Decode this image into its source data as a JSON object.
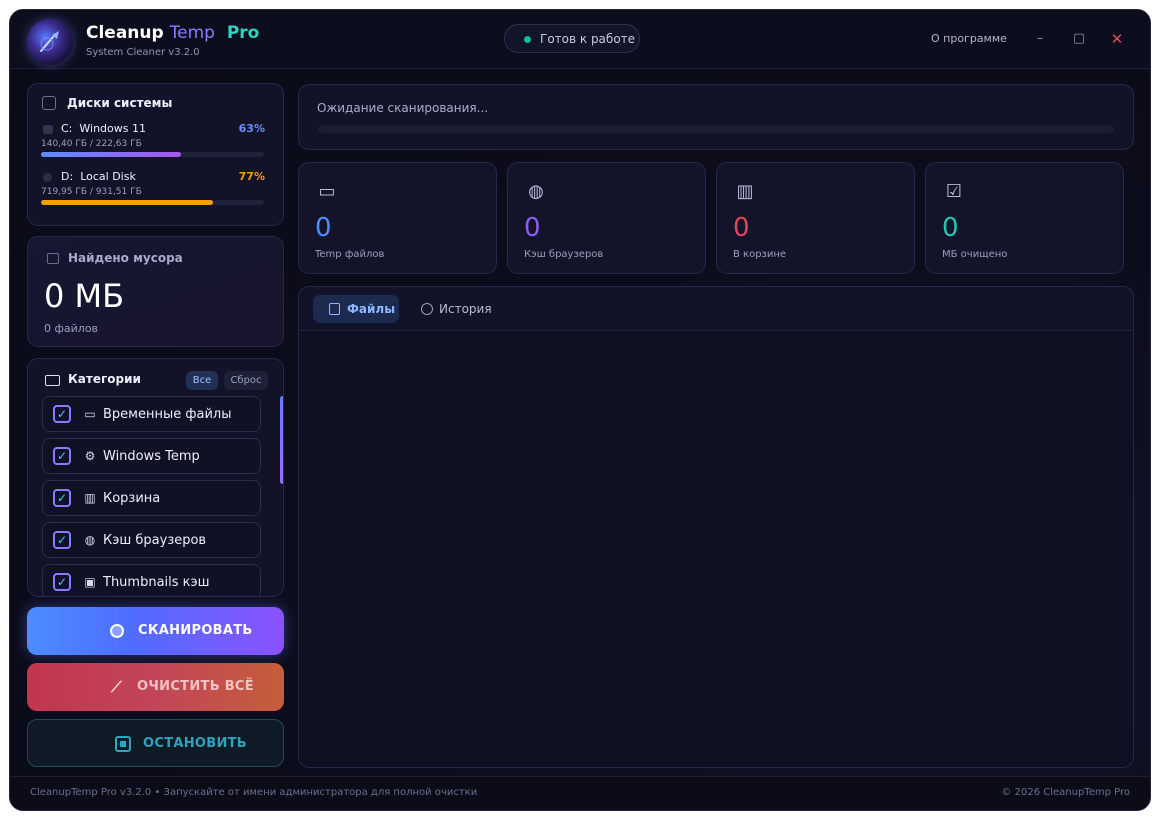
{
  "app": {
    "title_part1": "Cleanup",
    "title_part2": "Temp",
    "title_part3": "Pro",
    "subtitle": "System Cleaner v3.2.0",
    "status": "Готов к работе",
    "about": "О программе",
    "min_icon": "minimize-icon",
    "max_icon": "maximize-icon",
    "close_icon": "close-icon"
  },
  "disks": {
    "header": "Диски системы",
    "items": [
      {
        "letter": "C:",
        "name": "Windows 11",
        "percent": "63%",
        "size": "140,40 ГБ / 222,63 ГБ",
        "fill": 0.63,
        "color": "#6b8cff"
      },
      {
        "letter": "D:",
        "name": "Local Disk",
        "percent": "77%",
        "size": "719,95 ГБ / 931,51 ГБ",
        "fill": 0.77,
        "color": "#f59e0b"
      }
    ]
  },
  "found": {
    "header": "Найдено мусора",
    "value": "0 МБ",
    "count": "0 файлов"
  },
  "categories": {
    "header": "Категории",
    "all_label": "Все",
    "reset_label": "Сброс",
    "items": [
      {
        "label": "Временные файлы",
        "icon": "folder-icon",
        "glyph": "▭",
        "checked": true
      },
      {
        "label": "Windows Temp",
        "icon": "gear-icon",
        "glyph": "⚙",
        "checked": true
      },
      {
        "label": "Корзина",
        "icon": "trash-icon",
        "glyph": "🗑",
        "checked": true
      },
      {
        "label": "Кэш браузеров",
        "icon": "globe-icon",
        "glyph": "◍",
        "checked": true
      },
      {
        "label": "Thumbnails кэш",
        "icon": "image-icon",
        "glyph": "▣",
        "checked": true
      }
    ]
  },
  "actions": {
    "scan": "СКАНИРОВАТЬ",
    "clean": "ОЧИСТИТЬ ВСЁ",
    "stop": "ОСТАНОВИТЬ"
  },
  "progress": {
    "text": "Ожидание сканирования...",
    "value": 0
  },
  "stats": [
    {
      "value": "0",
      "label": "Temp файлов",
      "icon": "folder-icon",
      "color": "#4c8dff"
    },
    {
      "value": "0",
      "label": "Кэш браузеров",
      "icon": "globe-icon",
      "color": "#8b5cf6"
    },
    {
      "value": "0",
      "label": "В корзине",
      "icon": "trash-icon",
      "color": "#e0455f"
    },
    {
      "value": "0",
      "label": "МБ очищено",
      "icon": "check-icon",
      "color": "#22c5b0"
    }
  ],
  "tabs": {
    "files": "Файлы",
    "history": "История"
  },
  "footer": {
    "left": "CleanupTemp Pro v3.2.0  •  Запускайте от имени администратора для полной очистки",
    "right": "© 2026 CleanupTemp Pro"
  }
}
